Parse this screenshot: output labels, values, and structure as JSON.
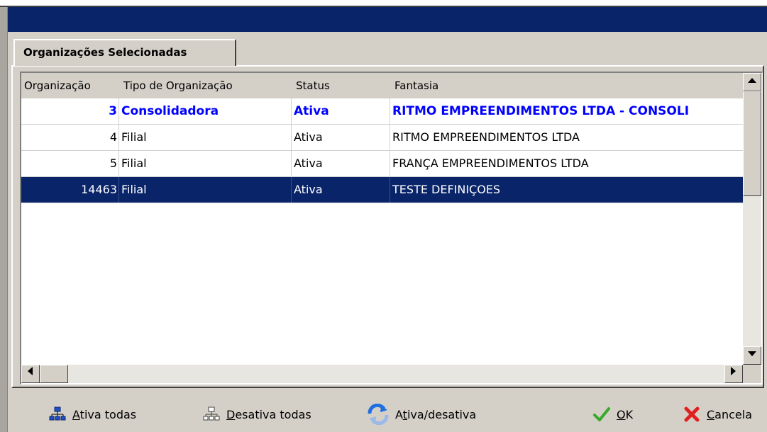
{
  "tab": {
    "label": "Organizações Selecionadas"
  },
  "grid": {
    "columns": [
      "Organização",
      "Tipo de Organização",
      "Status",
      "Fantasia"
    ],
    "rows": [
      {
        "organizacao": "3",
        "tipo": "Consolidadora",
        "status": "Ativa",
        "fantasia": "RITMO EMPREENDIMENTOS LTDA - CONSOLI",
        "style": "bold"
      },
      {
        "organizacao": "4",
        "tipo": "Filial",
        "status": "Ativa",
        "fantasia": "RITMO EMPREENDIMENTOS LTDA",
        "style": "normal"
      },
      {
        "organizacao": "5",
        "tipo": "Filial",
        "status": "Ativa",
        "fantasia": "FRANÇA EMPREENDIMENTOS LTDA",
        "style": "normal"
      },
      {
        "organizacao": "14463",
        "tipo": "Filial",
        "status": "Ativa",
        "fantasia": "TESTE DEFINIÇOES",
        "style": "selected"
      }
    ]
  },
  "buttons": {
    "ativa_todas": {
      "mnemonic": "A",
      "rest": "tiva todas"
    },
    "desativa_todas": {
      "mnemonic": "D",
      "rest": "esativa todas"
    },
    "ativa_desativa": {
      "before": "A",
      "mnemonic": "t",
      "rest": "iva/desativa"
    },
    "ok": {
      "mnemonic": "O",
      "rest": "K"
    },
    "cancela": {
      "mnemonic": "C",
      "rest": "ancela"
    }
  },
  "colors": {
    "titlebar": "#0a246a",
    "selection": "#0a246a",
    "highlight_text": "#0000ff"
  }
}
